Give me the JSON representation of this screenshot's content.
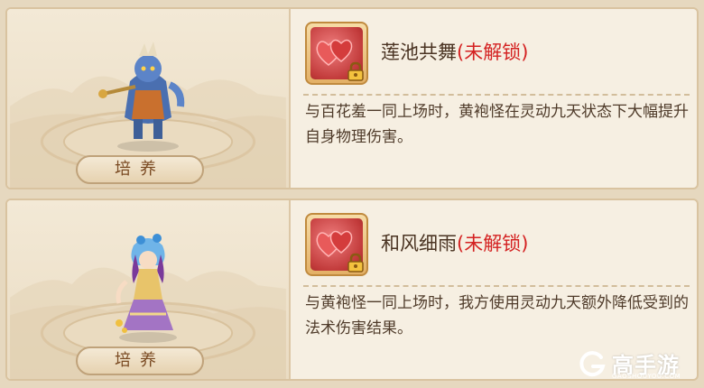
{
  "cards": [
    {
      "train_label": "培养",
      "skill_name": "莲池共舞",
      "lock_status": "(未解锁)",
      "description": "与百花羞一同上场时，黄袍怪在灵动九天状态下大幅提升自身物理伤害。",
      "character_icon": "demon-warrior-icon"
    },
    {
      "train_label": "培养",
      "skill_name": "和风细雨",
      "lock_status": "(未解锁)",
      "description": "与黄袍怪一同上场时，我方使用灵动九天额外降低受到的法术伤害结果。",
      "character_icon": "princess-icon"
    }
  ],
  "watermark": {
    "text": "高手游",
    "subtext": "GAOSHOUYOU.COM"
  },
  "colors": {
    "locked": "#d42222",
    "text": "#4a3322"
  }
}
